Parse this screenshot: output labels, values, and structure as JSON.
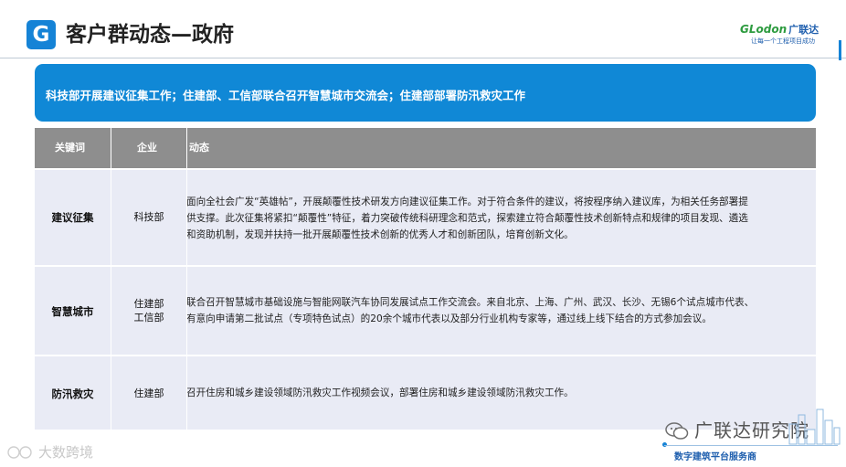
{
  "header": {
    "logo_letter": "G",
    "title": "客户群动态—政府",
    "brand_name": "GLodon",
    "brand_cn": "广联达",
    "tagline": "让每一个工程项目成功"
  },
  "banner": {
    "text": "科技部开展建议征集工作；住建部、工信部联合召开智慧城市交流会；住建部部署防汛救灾工作"
  },
  "table": {
    "columns": [
      "关键词",
      "企业",
      "动态"
    ],
    "rows": [
      {
        "keyword": "建议征集",
        "company": "科技部",
        "description": "面向全社会广发“英雄帖”，开展颠覆性技术研发方向建议征集工作。对于符合条件的建议，将按程序纳入建议库，为相关任务部署提\n供支撑。此次征集将紧扣“颠覆性”特征，着力突破传统科研理念和范式，探索建立符合颠覆性技术创新特点和规律的项目发现、遴选\n和资助机制，发现并扶持一批开展颠覆性技术创新的优秀人才和创新团队，培育创新文化。"
      },
      {
        "keyword": "智慧城市",
        "company": "住建部\n工信部",
        "description": "联合召开智慧城市基础设施与智能网联汽车协同发展试点工作交流会。来自北京、上海、广州、武汉、长沙、无锡6个试点城市代表、\n有意向申请第二批试点（专项特色试点）的20余个城市代表以及部分行业机构专家等，通过线上线下结合的方式参加会议。"
      },
      {
        "keyword": "防汛救灾",
        "company": "住建部",
        "description": "召开住房和城乡建设领域防汛救灾工作视频会议，部署住房和城乡建设领域防汛救灾工作。"
      }
    ]
  },
  "footer": {
    "wechat_name": "广联达研究院",
    "slogan": "数字建筑平台服务商",
    "watermark": "大数跨境"
  },
  "colors": {
    "accent_blue": "#1088d6",
    "header_gray": "#8e8e8e",
    "row_bg": "#e9ebf5",
    "brand_green": "#2d9b3f"
  }
}
